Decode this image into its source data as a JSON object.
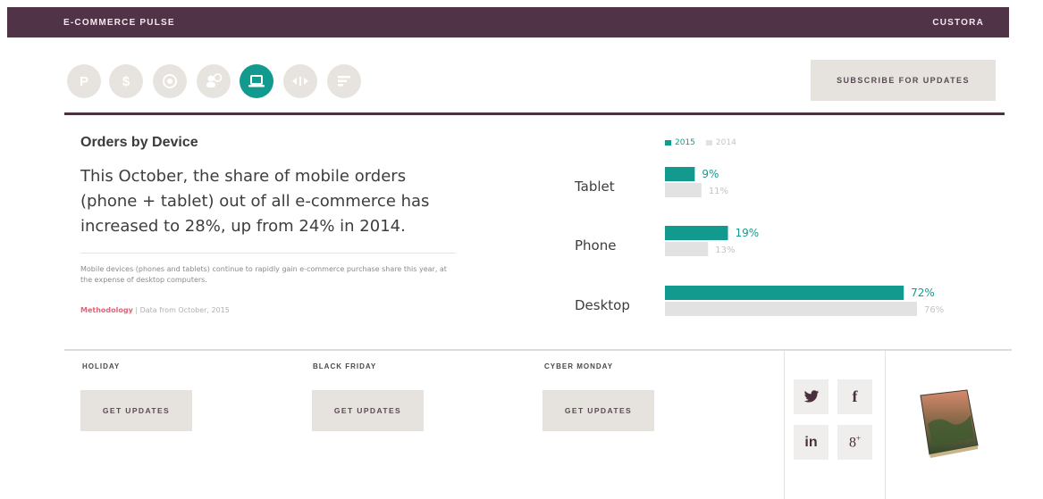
{
  "header": {
    "brand": "E-COMMERCE PULSE",
    "right_label": "CUSTORA"
  },
  "nav": {
    "icons": [
      {
        "name": "p-icon",
        "glyph": "P",
        "active": false
      },
      {
        "name": "dollar-icon",
        "glyph": "$",
        "active": false
      },
      {
        "name": "target-icon",
        "glyph": "◉",
        "active": false
      },
      {
        "name": "users-dollar-icon",
        "glyph": "☺",
        "active": false
      },
      {
        "name": "laptop-icon",
        "glyph": "",
        "active": true
      },
      {
        "name": "arrows-icon",
        "glyph": "◂▸",
        "active": false
      },
      {
        "name": "list-icon",
        "glyph": "≡",
        "active": false
      }
    ],
    "subscribe_label": "SUBSCRIBE FOR UPDATES"
  },
  "panel": {
    "title": "Orders by Device",
    "headline": "This October, the share of mobile orders (phone + tablet) out of all e-commerce has increased to 28%, up from 24% in 2014.",
    "description": "Mobile devices (phones and tablets) continue to rapidly gain e-commerce purchase share this year, at the expense of desktop computers.",
    "methodology_link": "Methodology",
    "source": "| Data from October, 2015"
  },
  "colors": {
    "accent": "#139a8e",
    "prior": "#e2e2e2",
    "prior_text": "#c4c4c4",
    "header_bg": "#503346",
    "button_bg": "#e6e2dd"
  },
  "chart_data": {
    "type": "bar",
    "orientation": "horizontal",
    "categories": [
      "Tablet",
      "Phone",
      "Desktop"
    ],
    "series": [
      {
        "name": "2015",
        "values": [
          9,
          19,
          72
        ]
      },
      {
        "name": "2014",
        "values": [
          11,
          13,
          76
        ]
      }
    ],
    "value_labels": [
      [
        "9%",
        "19%",
        "72%"
      ],
      [
        "11%",
        "13%",
        "76%"
      ]
    ],
    "unit": "%",
    "xlim": [
      0,
      76
    ],
    "legend": "top",
    "grid": false
  },
  "events": [
    {
      "label": "HOLIDAY",
      "button": "GET UPDATES"
    },
    {
      "label": "BLACK FRIDAY",
      "button": "GET UPDATES"
    },
    {
      "label": "CYBER MONDAY",
      "button": "GET UPDATES"
    }
  ],
  "social": [
    {
      "name": "twitter-icon",
      "glyph": "🐦"
    },
    {
      "name": "facebook-icon",
      "glyph": "f"
    },
    {
      "name": "linkedin-icon",
      "glyph": "in"
    },
    {
      "name": "google-plus-icon",
      "glyph": "8+"
    }
  ]
}
